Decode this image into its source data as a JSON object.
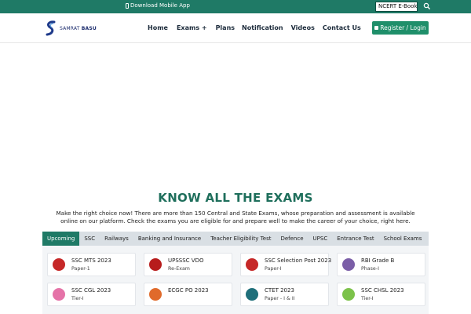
{
  "topbar": {
    "download_label": "Download Mobile App",
    "ncert_label": "NCERT E-Books",
    "search_icon": "search-icon"
  },
  "header": {
    "logo_text_1": "SAMRAT",
    "logo_text_2": "BASU",
    "nav": [
      "Home",
      "Exams +",
      "Plans",
      "Notification",
      "Videos",
      "Contact Us"
    ],
    "register_label": "Register / Login"
  },
  "exams": {
    "title": "KNOW ALL THE EXAMS",
    "description": "Make the right choice now! There are more than 150 Central and State Exams, whose preparation and assessment is available online on our platform. Check the exams you are eligible for and prepare well to make the career of your choice, right here.",
    "tabs": [
      "Upcoming",
      "SSC",
      "Railways",
      "Banking and Insurance",
      "Teacher Eligibility Test",
      "Defence",
      "UPSC",
      "Entrance Test",
      "School Exams"
    ],
    "active_tab": "Upcoming",
    "cards": [
      {
        "name": "SSC MTS 2023",
        "sub": "Paper-1",
        "icon_color": "#c62828"
      },
      {
        "name": "UPSSSC VDO",
        "sub": "Re-Exam",
        "icon_color": "#b71c1c"
      },
      {
        "name": "SSC Selection Post 2023",
        "sub": "Paper-I",
        "icon_color": "#c62828"
      },
      {
        "name": "RBI Grade B",
        "sub": "Phase-I",
        "icon_color": "#7b5ea7"
      },
      {
        "name": "SSC CGL 2023",
        "sub": "Tier-I",
        "icon_color": "#e573a8"
      },
      {
        "name": "ECGC PO 2023",
        "sub": "",
        "icon_color": "#e06a2b"
      },
      {
        "name": "CTET 2023",
        "sub": "Paper - I & II",
        "icon_color": "#1f6f7a"
      },
      {
        "name": "SSC CHSL 2023",
        "sub": "Tier-I",
        "icon_color": "#7cc24a"
      }
    ]
  },
  "colors": {
    "brand_green": "#1f7a66",
    "button_green": "#1f8f6a",
    "tab_bar": "#d9dfe4"
  }
}
